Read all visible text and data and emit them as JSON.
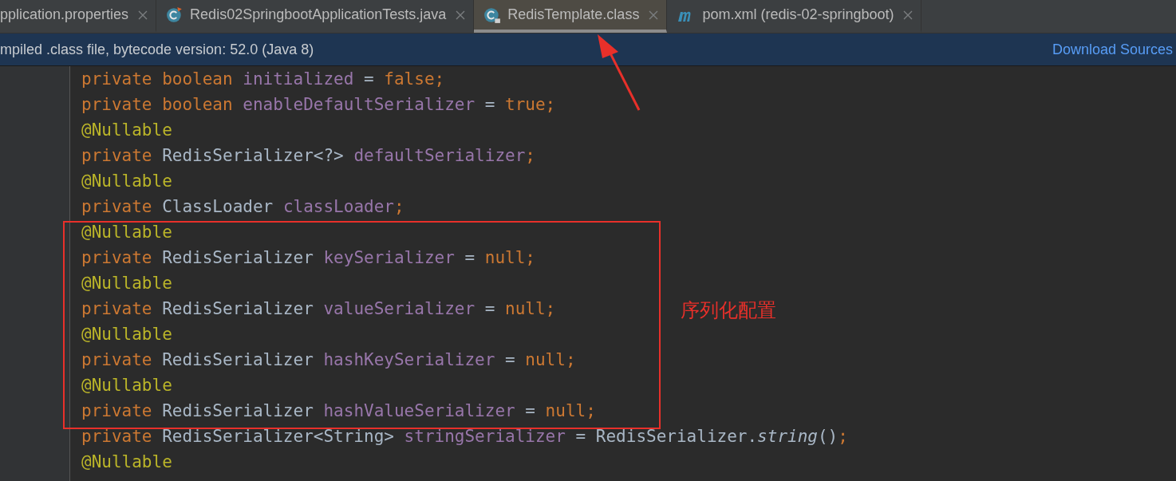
{
  "tabs": [
    {
      "label": "pplication.properties",
      "selected": false
    },
    {
      "label": "Redis02SpringbootApplicationTests.java",
      "selected": false
    },
    {
      "label": "RedisTemplate.class",
      "selected": true
    },
    {
      "label": "pom.xml (redis-02-springboot)",
      "selected": false
    }
  ],
  "banner": {
    "message": "mpiled .class file, bytecode version: 52.0 (Java 8)",
    "link": "Download Sources"
  },
  "code_lines": [
    {
      "tokens": [
        {
          "kind": "keyword",
          "text": "private boolean "
        },
        {
          "kind": "field",
          "text": "initialized"
        },
        {
          "kind": "plain",
          "text": " = "
        },
        {
          "kind": "keyword",
          "text": "false;"
        }
      ]
    },
    {
      "tokens": [
        {
          "kind": "keyword",
          "text": "private boolean "
        },
        {
          "kind": "field",
          "text": "enableDefaultSerializer"
        },
        {
          "kind": "plain",
          "text": " = "
        },
        {
          "kind": "keyword",
          "text": "true;"
        }
      ]
    },
    {
      "tokens": [
        {
          "kind": "annotation",
          "text": "@Nullable"
        }
      ]
    },
    {
      "tokens": [
        {
          "kind": "keyword",
          "text": "private "
        },
        {
          "kind": "plain",
          "text": "RedisSerializer<?> "
        },
        {
          "kind": "field",
          "text": "defaultSerializer"
        },
        {
          "kind": "keyword",
          "text": ";"
        }
      ]
    },
    {
      "tokens": [
        {
          "kind": "annotation",
          "text": "@Nullable"
        }
      ]
    },
    {
      "tokens": [
        {
          "kind": "keyword",
          "text": "private "
        },
        {
          "kind": "plain",
          "text": "ClassLoader "
        },
        {
          "kind": "field",
          "text": "classLoader"
        },
        {
          "kind": "keyword",
          "text": ";"
        }
      ]
    },
    {
      "tokens": [
        {
          "kind": "annotation",
          "text": "@Nullable"
        }
      ]
    },
    {
      "tokens": [
        {
          "kind": "keyword",
          "text": "private "
        },
        {
          "kind": "plain",
          "text": "RedisSerializer "
        },
        {
          "kind": "field",
          "text": "keySerializer"
        },
        {
          "kind": "plain",
          "text": " = "
        },
        {
          "kind": "keyword",
          "text": "null;"
        }
      ]
    },
    {
      "tokens": [
        {
          "kind": "annotation",
          "text": "@Nullable"
        }
      ]
    },
    {
      "tokens": [
        {
          "kind": "keyword",
          "text": "private "
        },
        {
          "kind": "plain",
          "text": "RedisSerializer "
        },
        {
          "kind": "field",
          "text": "valueSerializer"
        },
        {
          "kind": "plain",
          "text": " = "
        },
        {
          "kind": "keyword",
          "text": "null;"
        }
      ]
    },
    {
      "tokens": [
        {
          "kind": "annotation",
          "text": "@Nullable"
        }
      ]
    },
    {
      "tokens": [
        {
          "kind": "keyword",
          "text": "private "
        },
        {
          "kind": "plain",
          "text": "RedisSerializer "
        },
        {
          "kind": "field",
          "text": "hashKeySerializer"
        },
        {
          "kind": "plain",
          "text": " = "
        },
        {
          "kind": "keyword",
          "text": "null;"
        }
      ]
    },
    {
      "tokens": [
        {
          "kind": "annotation",
          "text": "@Nullable"
        }
      ]
    },
    {
      "tokens": [
        {
          "kind": "keyword",
          "text": "private "
        },
        {
          "kind": "plain",
          "text": "RedisSerializer "
        },
        {
          "kind": "field",
          "text": "hashValueSerializer"
        },
        {
          "kind": "plain",
          "text": " = "
        },
        {
          "kind": "keyword",
          "text": "null;"
        }
      ]
    },
    {
      "tokens": [
        {
          "kind": "keyword",
          "text": "private "
        },
        {
          "kind": "plain",
          "text": "RedisSerializer<String> "
        },
        {
          "kind": "field",
          "text": "stringSerializer"
        },
        {
          "kind": "plain",
          "text": " = RedisSerializer."
        },
        {
          "kind": "method",
          "text": "string"
        },
        {
          "kind": "plain",
          "text": "()"
        },
        {
          "kind": "keyword",
          "text": ";"
        }
      ]
    },
    {
      "tokens": [
        {
          "kind": "annotation",
          "text": "@Nullable"
        }
      ]
    }
  ],
  "annotation_note": "序列化配置"
}
